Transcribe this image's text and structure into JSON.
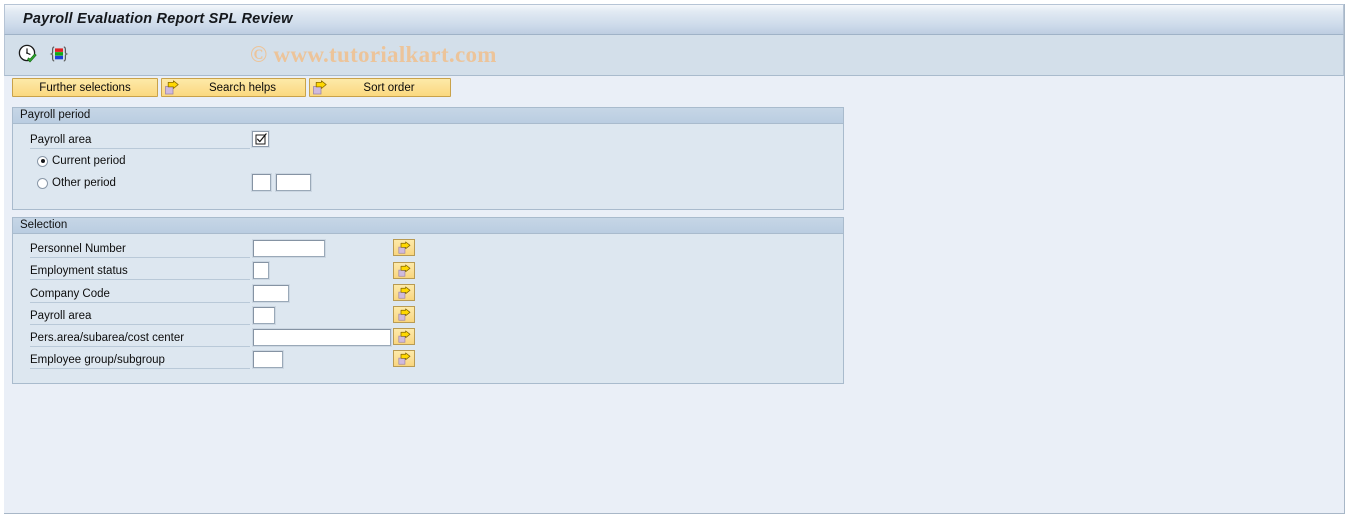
{
  "window": {
    "title": "Payroll Evaluation Report SPL Review"
  },
  "watermark": {
    "text": "© www.tutorialkart.com"
  },
  "toolbar": {
    "icons": [
      {
        "name": "execute-clock-icon",
        "title": "Execute"
      },
      {
        "name": "multiple-selection-icon",
        "title": "Multiple selection"
      }
    ]
  },
  "action_buttons": [
    {
      "key": "further_selections",
      "label": "Further selections",
      "icon": "none"
    },
    {
      "key": "search_helps",
      "label": "Search helps",
      "icon": "arrow-right-icon"
    },
    {
      "key": "sort_order",
      "label": "Sort order",
      "icon": "arrow-right-icon"
    }
  ],
  "payroll_period": {
    "title": "Payroll period",
    "payroll_area": {
      "label": "Payroll area",
      "value": "",
      "picker_icon": "checkbox-checked-icon"
    },
    "radio_options": [
      {
        "key": "current_period",
        "label": "Current period",
        "selected": true
      },
      {
        "key": "other_period",
        "label": "Other period",
        "selected": false
      }
    ],
    "other_period_fields": [
      {
        "key": "other_period_small",
        "value": "",
        "placeholder": ""
      },
      {
        "key": "other_period_year",
        "value": "",
        "placeholder": ""
      }
    ]
  },
  "selection": {
    "title": "Selection",
    "rows": [
      {
        "key": "personnel_number",
        "label": "Personnel Number",
        "value": "",
        "field_width": 72,
        "multi_icon": "arrow-right-icon"
      },
      {
        "key": "employment_status",
        "label": "Employment status",
        "value": "",
        "field_width": 16,
        "multi_icon": "arrow-right-icon"
      },
      {
        "key": "company_code",
        "label": "Company Code",
        "value": "",
        "field_width": 36,
        "multi_icon": "arrow-right-icon"
      },
      {
        "key": "payroll_area",
        "label": "Payroll area",
        "value": "",
        "field_width": 22,
        "multi_icon": "arrow-right-icon"
      },
      {
        "key": "pers_area_subarea_cost_center",
        "label": "Pers.area/subarea/cost center",
        "value": "",
        "field_width": 138,
        "multi_icon": "arrow-right-icon"
      },
      {
        "key": "employee_group_subgroup",
        "label": "Employee group/subgroup",
        "value": "",
        "field_width": 30,
        "multi_icon": "arrow-right-icon"
      }
    ]
  },
  "colors": {
    "title_bar_top": "#f4f7fb",
    "title_bar_bottom": "#bdcde1",
    "toolbar_bg": "#d3dfea",
    "canvas_bg": "#eaeff7",
    "group_bg": "#dde7f0",
    "group_header": "#c0d2e4",
    "button_yellow": "#fce196",
    "button_border": "#c9a24a",
    "watermark": "#ecc49a",
    "arrow_yellow": "#ffd800",
    "arrow_shadow": "#cfbadd"
  }
}
